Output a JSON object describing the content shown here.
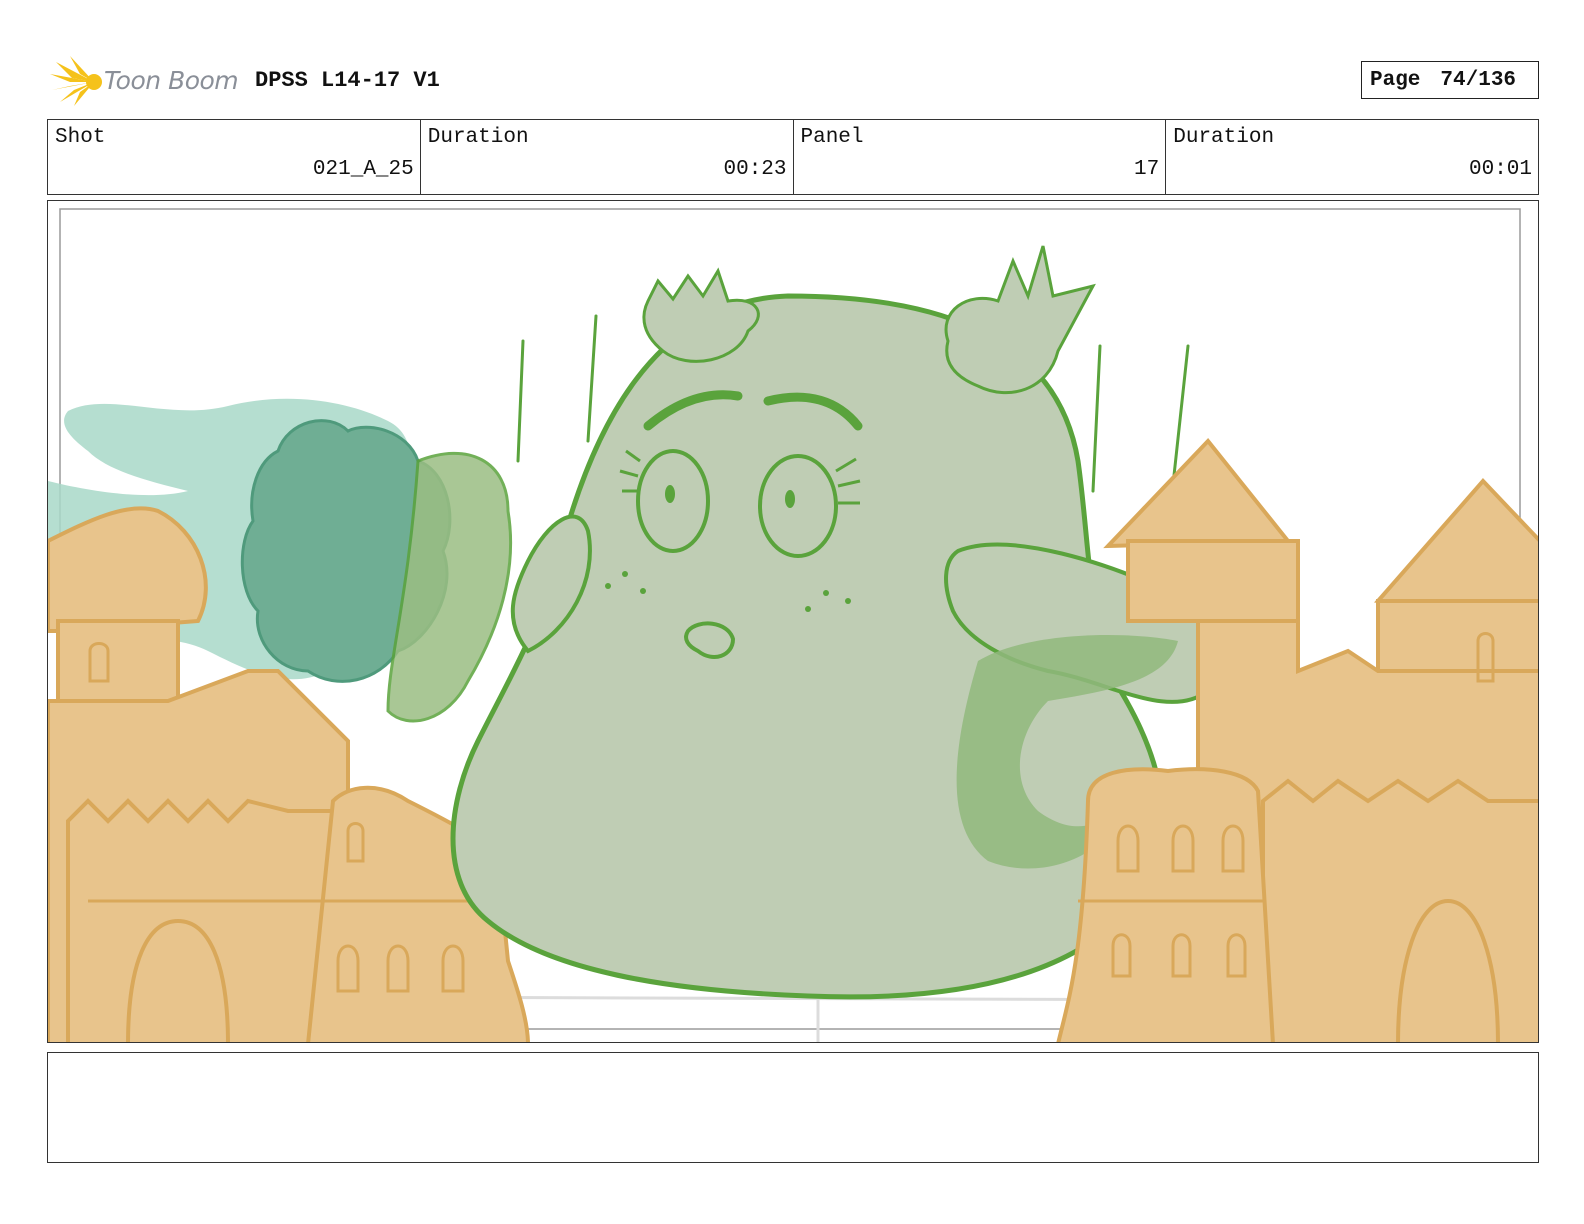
{
  "header": {
    "brand": "Toon Boom",
    "title": "DPSS L14-17 V1",
    "page_label": "Page",
    "page_value": "74/136"
  },
  "info": {
    "shot_label": "Shot",
    "shot_value": "021_A_25",
    "duration_label": "Duration",
    "duration_value": "00:23",
    "panel_label": "Panel",
    "panel_value": "17",
    "panel_duration_label": "Duration",
    "panel_duration_value": "00:01"
  },
  "colors": {
    "sand": "#e8c48c",
    "sand_line": "#d9a85a",
    "creature_fill": "#bfcdb4",
    "creature_line": "#5aa33c",
    "smoke": "#a8d8c8",
    "puff": "#6fae94",
    "logo_yellow": "#f5c21b"
  },
  "notes": ""
}
